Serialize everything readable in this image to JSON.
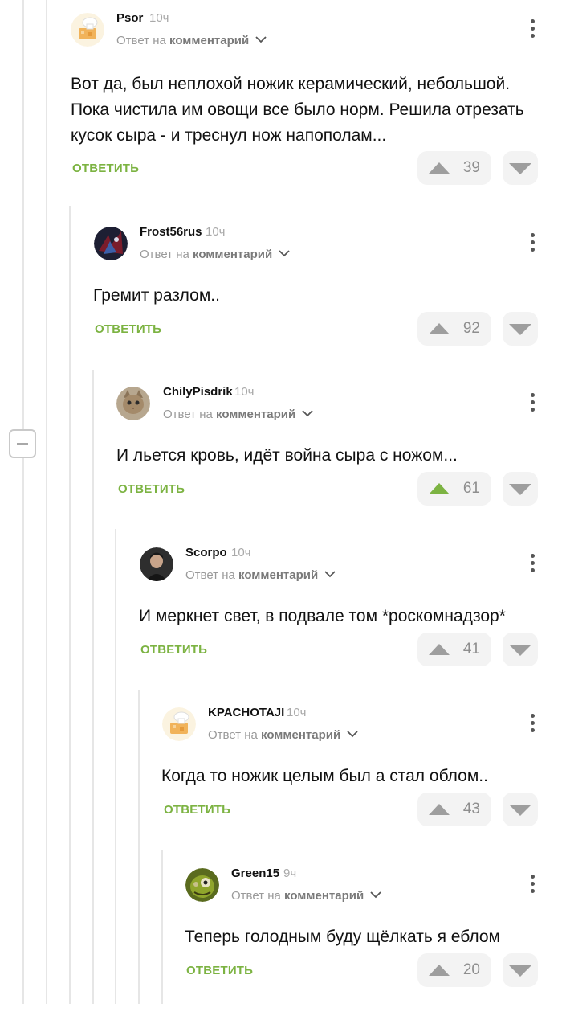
{
  "common": {
    "reply_prefix": "Ответ на",
    "reply_target": "комментарий",
    "reply_button": "ОТВЕТИТЬ"
  },
  "colors": {
    "accent": "#7cb342",
    "muted": "#9a9a9a",
    "box": "#f3f3f3"
  },
  "comments": [
    {
      "author": "Psor",
      "time": "10ч",
      "avatar": "chef-avatar-icon",
      "lines": [
        "Вот да, был неплохой ножик керамический, небольшой.",
        "Пока чистила им овощи все было норм. Решила отрезать",
        "кусок сыра - и треснул нож напополам..."
      ],
      "votes": "39",
      "upvoted": false
    },
    {
      "author": "Frost56rus",
      "time": "10ч",
      "avatar": "fantasy-avatar-icon",
      "lines": [
        "Гремит разлом.."
      ],
      "votes": "92",
      "upvoted": false
    },
    {
      "author": "ChilyPisdrik",
      "time": "10ч",
      "avatar": "cat-avatar-icon",
      "lines": [
        "И льется кровь, идёт война сыра с ножом..."
      ],
      "votes": "61",
      "upvoted": true
    },
    {
      "author": "Scorpo",
      "time": "10ч",
      "avatar": "man-avatar-icon",
      "lines": [
        "И меркнет свет, в подвале том *роскомнадзор*"
      ],
      "votes": "41",
      "upvoted": false
    },
    {
      "author": "KPACHOTAJI",
      "time": "10ч",
      "avatar": "chef-avatar-icon",
      "lines": [
        "Когда то ножик целым был а стал облом.."
      ],
      "votes": "43",
      "upvoted": false
    },
    {
      "author": "Green15",
      "time": "9ч",
      "avatar": "monster-avatar-icon",
      "lines": [
        "Теперь голодным буду щёлкать я еблом"
      ],
      "votes": "20",
      "upvoted": false
    }
  ]
}
